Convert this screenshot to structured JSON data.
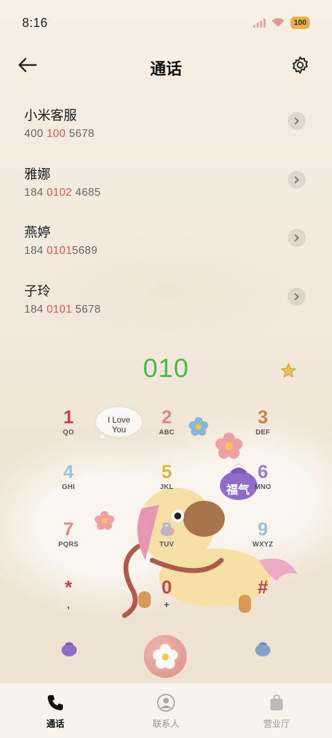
{
  "status_bar": {
    "time": "8:16",
    "battery": "100"
  },
  "header": {
    "title": "通话"
  },
  "contacts": [
    {
      "name": "小米客服",
      "num_pre": "400 ",
      "num_hl": "100",
      "num_post": " 5678"
    },
    {
      "name": "雅娜",
      "num_pre": "184 ",
      "num_hl": "0102",
      "num_post": " 4685"
    },
    {
      "name": "燕婷",
      "num_pre": "184 ",
      "num_hl": "0101",
      "num_post": "5689"
    },
    {
      "name": "子玲",
      "num_pre": "184 ",
      "num_hl": "0101",
      "num_post": " 5678"
    }
  ],
  "dialer": {
    "input": "010"
  },
  "keypad": {
    "k1": {
      "digit": "1",
      "letters": "QO"
    },
    "k2": {
      "digit": "2",
      "letters": "ABC"
    },
    "k3": {
      "digit": "3",
      "letters": "DEF"
    },
    "k4": {
      "digit": "4",
      "letters": "GHI"
    },
    "k5": {
      "digit": "5",
      "letters": "JKL"
    },
    "k6": {
      "digit": "6",
      "letters": "MNO"
    },
    "k7": {
      "digit": "7",
      "letters": "PQRS"
    },
    "k8": {
      "digit": "8",
      "letters": "TUV"
    },
    "k9": {
      "digit": "9",
      "letters": "WXYZ"
    },
    "kstar": {
      "digit": "*",
      "letters": ","
    },
    "k0": {
      "digit": "0",
      "letters": "+"
    },
    "khash": {
      "digit": "#",
      "letters": ""
    }
  },
  "decor": {
    "cloud_text_1": "I Love",
    "cloud_text_2": "You",
    "pouch_text": "福气",
    "mini_text": "福"
  },
  "nav": {
    "tab_calls": "通话",
    "tab_contacts": "联系人",
    "tab_store": "营业厅"
  },
  "colors": {
    "highlight": "#e05252",
    "dialed": "#49b849",
    "key_1": "#c2434f",
    "key_2": "#e0858f",
    "key_3": "#c98540",
    "key_4": "#9fc1d8",
    "key_5": "#cdb93f",
    "key_6": "#9b7ad6",
    "key_7": "#e08a8a",
    "key_8": "#9fc1d8",
    "key_9": "#9fc1d8"
  }
}
